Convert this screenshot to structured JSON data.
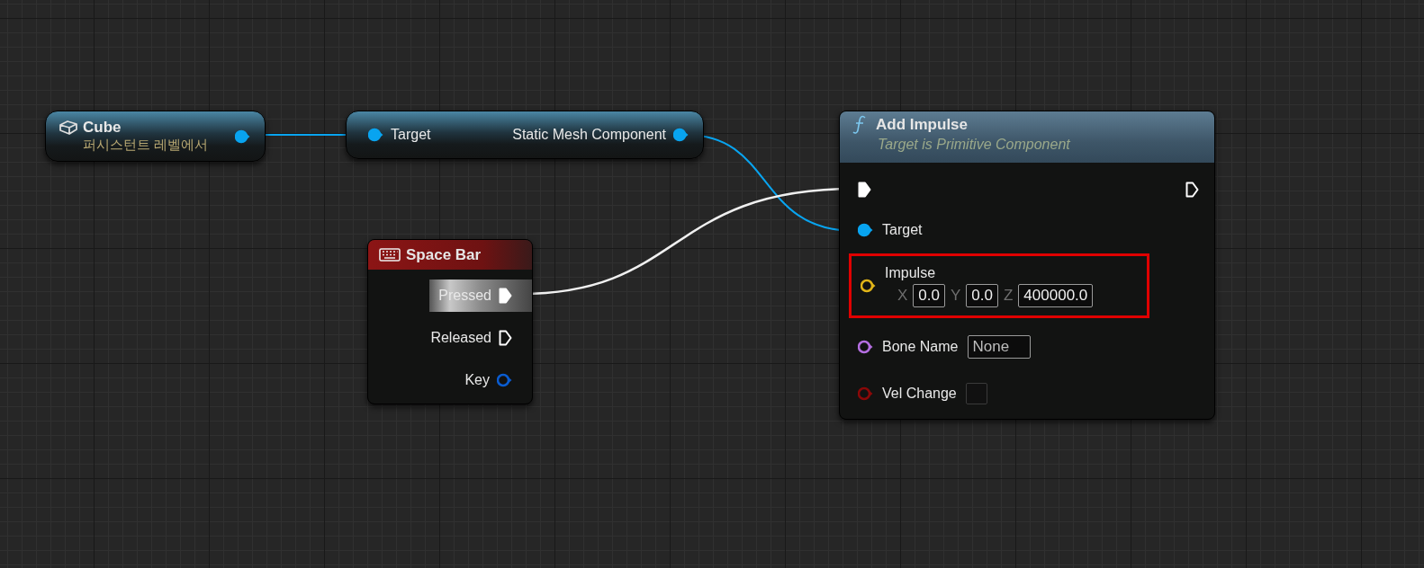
{
  "nodes": [
    {
      "kind": "variable",
      "title": "Cube",
      "subtitle": "퍼시스턴트 레벨에서",
      "pins": [
        {
          "kind": "data",
          "color": "#08a4f0",
          "connected": true
        }
      ]
    },
    {
      "kind": "getter",
      "pins": [
        {
          "label": "Target",
          "kind": "data",
          "color": "#08a4f0",
          "connected": true
        },
        {
          "label": "Static Mesh Component",
          "kind": "data",
          "color": "#08a4f0",
          "connected": true
        }
      ]
    },
    {
      "kind": "event",
      "title": "Space Bar",
      "pins": [
        {
          "label": "Pressed",
          "kind": "exec",
          "color": "#ffffff",
          "connected": true,
          "highlighted": true
        },
        {
          "label": "Released",
          "kind": "exec",
          "color": "#ffffff",
          "connected": false,
          "highlighted": false
        },
        {
          "label": "Key",
          "kind": "data",
          "color": "#0a5cd0",
          "connected": false,
          "highlighted": false
        }
      ]
    },
    {
      "kind": "function",
      "title": "Add Impulse",
      "subtitle": "Target is Primitive Component",
      "rows": [
        {
          "kind": "exec",
          "highlighted": false,
          "pins": [
            {
              "kind": "exec",
              "color": "#ffffff",
              "connected": true
            },
            {
              "kind": "exec",
              "color": "#ffffff",
              "connected": false
            }
          ]
        },
        {
          "kind": "pin",
          "highlighted": false,
          "label": "Target",
          "pin": {
            "kind": "data",
            "color": "#08a4f0",
            "connected": true
          }
        },
        {
          "kind": "vector",
          "highlighted": true,
          "label": "Impulse",
          "pin": {
            "kind": "data",
            "color": "#e0b418",
            "connected": false
          },
          "fields": [
            {
              "axis": "X",
              "value": "0.0"
            },
            {
              "axis": "Y",
              "value": "0.0"
            },
            {
              "axis": "Z",
              "value": "400000.0"
            }
          ]
        },
        {
          "kind": "text",
          "highlighted": false,
          "label": "Bone Name",
          "pin": {
            "kind": "data",
            "color": "#b46ee0",
            "connected": false
          },
          "value": "None"
        },
        {
          "kind": "checkbox",
          "highlighted": false,
          "label": "Vel Change",
          "pin": {
            "kind": "data",
            "color": "#8a0808",
            "connected": false
          },
          "checked": false
        }
      ]
    }
  ]
}
